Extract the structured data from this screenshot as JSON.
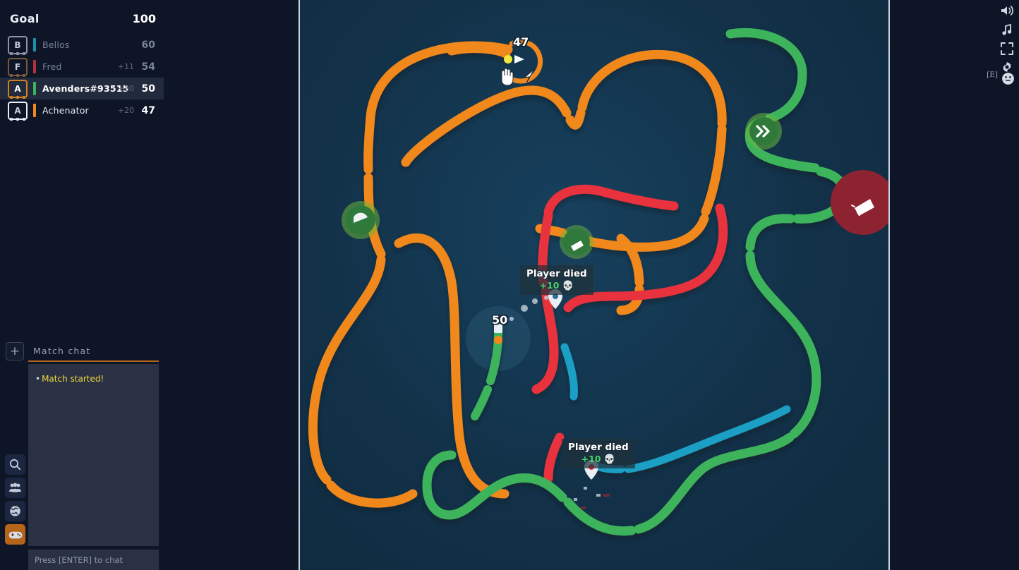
{
  "goal": {
    "label": "Goal",
    "value": "100"
  },
  "leaderboard": [
    {
      "initial": "B",
      "name": "Bellos",
      "delta": "",
      "score": "60",
      "bar_color": "#1d8fa8",
      "frame_color": "#8c96a8",
      "highlight": false
    },
    {
      "initial": "F",
      "name": "Fred",
      "delta": "+11",
      "score": "54",
      "bar_color": "#b0323c",
      "frame_color": "#7a5a3a",
      "highlight": false
    },
    {
      "initial": "A",
      "name": "Avenders#93515",
      "delta": "+20",
      "score": "50",
      "bar_color": "#3cb45c",
      "frame_color": "#d4821e",
      "highlight": true
    },
    {
      "initial": "A",
      "name": "Achenator",
      "delta": "+20",
      "score": "47",
      "bar_color": "#f0881e",
      "frame_color": "#e8eef6",
      "highlight": false
    }
  ],
  "chat": {
    "add_label": "+",
    "title": "Match chat",
    "messages": [
      {
        "bullet": "•",
        "text": "Match started!"
      }
    ],
    "input_placeholder": "Press [ENTER] to chat"
  },
  "sidebar_nav": [
    {
      "icon": "search-icon",
      "active": false
    },
    {
      "icon": "friends-icon",
      "active": false
    },
    {
      "icon": "globe-icon",
      "active": false
    },
    {
      "icon": "gamepad-icon",
      "active": true
    }
  ],
  "right_rail": [
    {
      "icon": "sound-icon"
    },
    {
      "icon": "music-icon"
    },
    {
      "icon": "fullscreen-icon"
    },
    {
      "icon": "gear-icon"
    },
    {
      "icon": "emoji-icon"
    }
  ],
  "emoji_hotkey": "[E]",
  "board": {
    "player_score": "50",
    "rival_score": "47",
    "death_toasts": [
      {
        "title": "Player died",
        "bonus": "+10",
        "skull": "💀",
        "pin_color": "#ffffff"
      },
      {
        "title": "Player died",
        "bonus": "+10",
        "skull": "💀",
        "pin_color": "#e8323c"
      }
    ],
    "cursors": [
      "hand-cursor",
      "arrow-cursor"
    ],
    "powerups": [
      {
        "name": "boost-powerup",
        "icon": "double-chevron-icon",
        "color": "#2f7a3a"
      },
      {
        "name": "megaphone-powerup",
        "icon": "megaphone-icon",
        "color": "#8d2330"
      },
      {
        "name": "shield-powerup",
        "icon": "shield-icon",
        "color": "#2f7a3a"
      },
      {
        "name": "megaphone-powerup2",
        "icon": "megaphone-icon",
        "color": "#2f7a3a"
      }
    ],
    "colors": {
      "orange": "#f0881e",
      "red": "#e8323c",
      "green": "#3cb45c",
      "cyan": "#1b9fc4",
      "background": "#123148"
    }
  }
}
